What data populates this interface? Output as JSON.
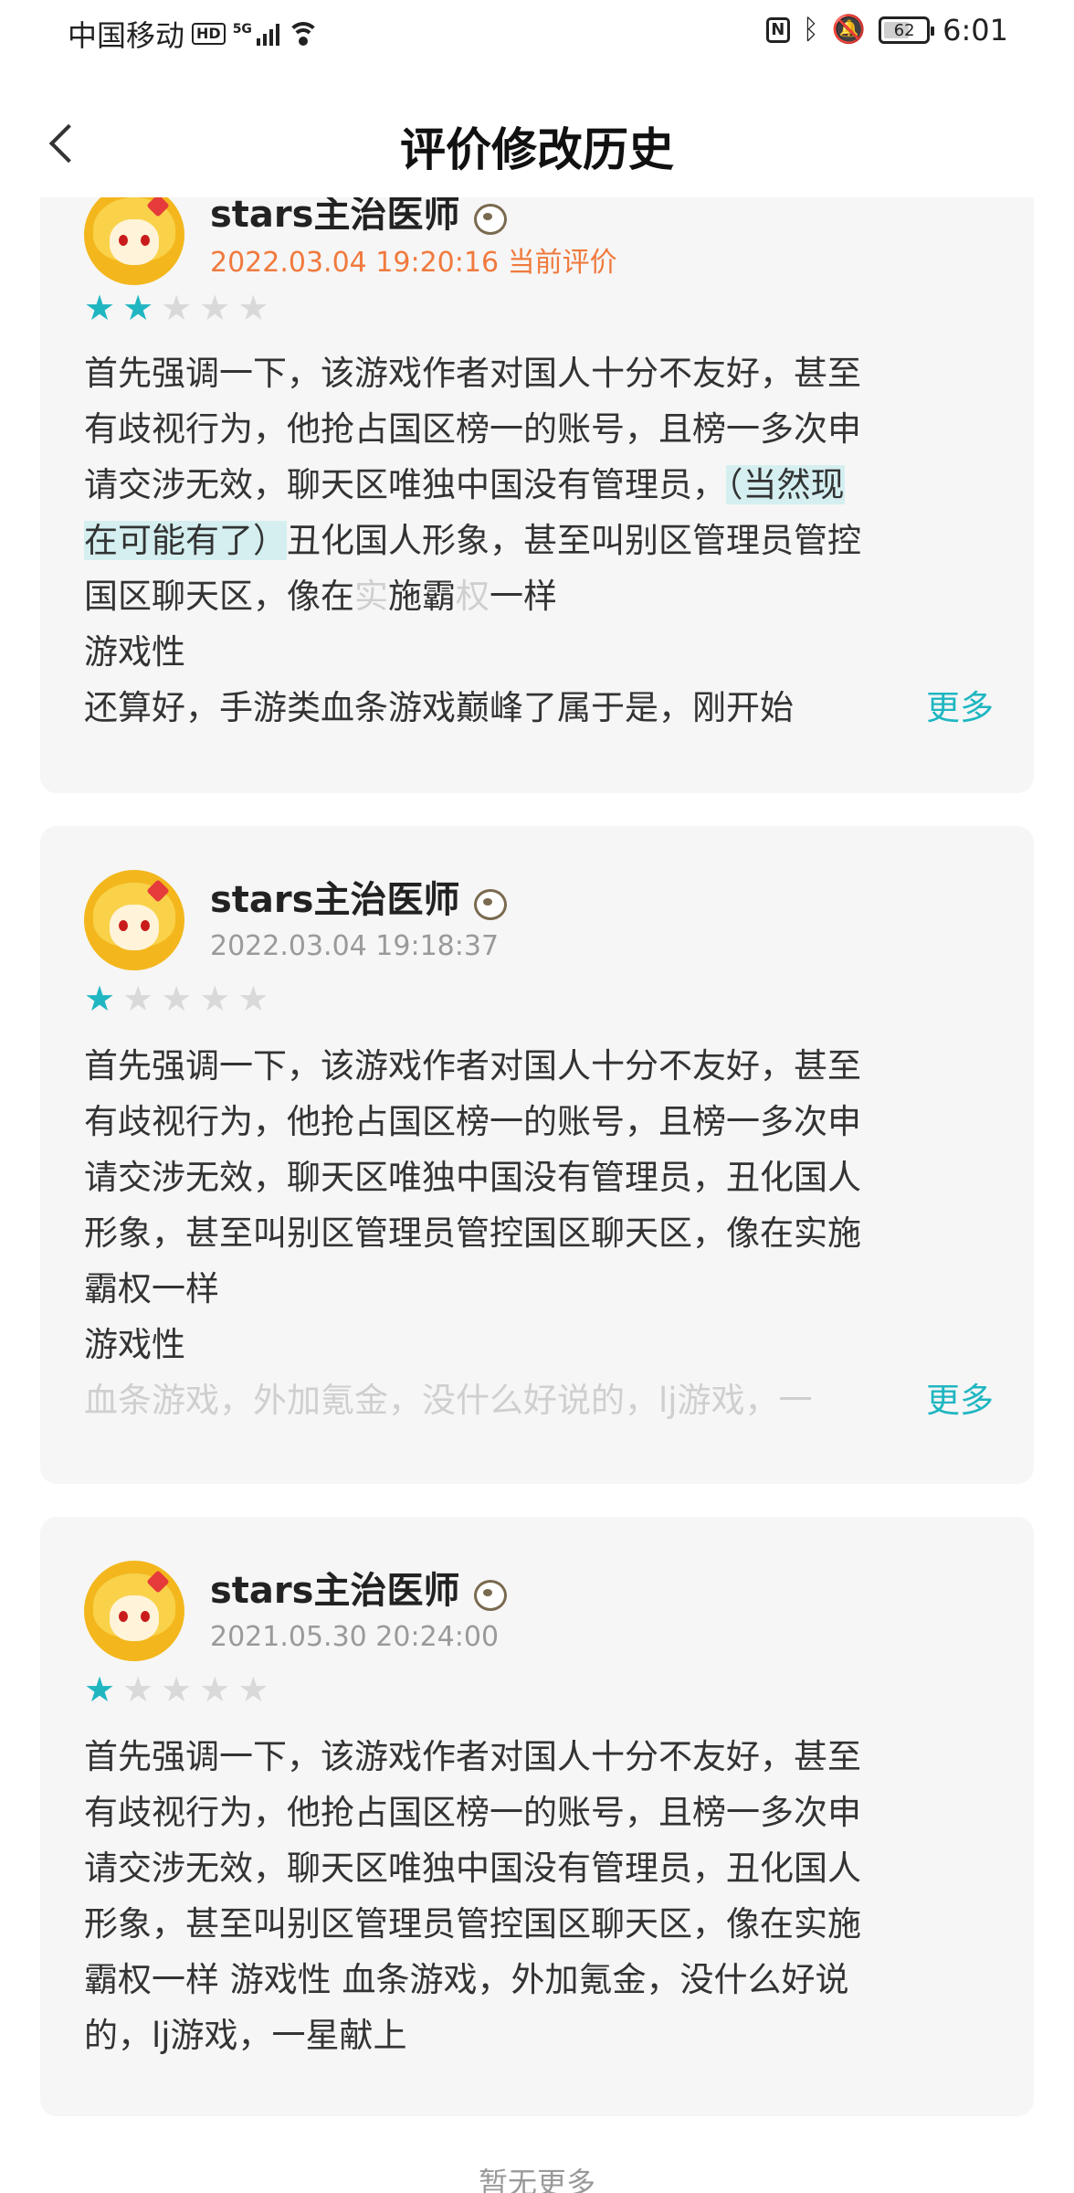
{
  "status_bar": {
    "carrier": "中国移动",
    "hd": "HD",
    "network": "5G",
    "nfc": "N",
    "battery_level": 62,
    "battery_text": "62",
    "time": "6:01"
  },
  "header": {
    "title": "评价修改历史"
  },
  "reviews": [
    {
      "user_name": "stars主治医师",
      "time": "2022.03.04 19:20:16",
      "current_label": "当前评价",
      "rating": 2,
      "lines": [
        "首先强调一下，该游戏作者对国人十分不友好，甚至",
        "有歧视行为，他抢占国区榜一的账号，且榜一多次申",
        "请交涉无效，聊天区唯独中国没有管理员，",
        "（当然现",
        "在可能有了）",
        "丑化国人形象，甚至叫别区管理员管控",
        "国区聊天区，像在",
        "实",
        "施霸",
        "权",
        "一样",
        "游戏性",
        "还算好，手游类血条游戏巅峰了属于是，刚开始"
      ],
      "more": "更多"
    },
    {
      "user_name": "stars主治医师",
      "time": "2022.03.04 19:18:37",
      "rating": 1,
      "lines": [
        "首先强调一下，该游戏作者对国人十分不友好，甚至",
        "有歧视行为，他抢占国区榜一的账号，且榜一多次申",
        "请交涉无效，聊天区唯独中国没有管理员，丑化国人",
        "形象，甚至叫别区管理员管控国区聊天区，像在实施",
        "霸权一样",
        "游戏性",
        "血条游戏，外加氪金，没什么好说的，lj游戏，一"
      ],
      "more": "更多"
    },
    {
      "user_name": "stars主治医师",
      "time": "2021.05.30 20:24:00",
      "rating": 1,
      "lines": [
        "首先强调一下，该游戏作者对国人十分不友好，甚至",
        "有歧视行为，他抢占国区榜一的账号，且榜一多次申",
        "请交涉无效，聊天区唯独中国没有管理员，丑化国人",
        "形象，甚至叫别区管理员管控国区聊天区，像在实施",
        "霸权一样 游戏性 血条游戏，外加氪金，没什么好说",
        "的，lj游戏，一星献上"
      ]
    }
  ],
  "footer": {
    "no_more": "暂无更多"
  },
  "colors": {
    "accent": "#1fb6c1",
    "current_label": "#f07a3e",
    "card_bg": "#f6f6f6"
  }
}
